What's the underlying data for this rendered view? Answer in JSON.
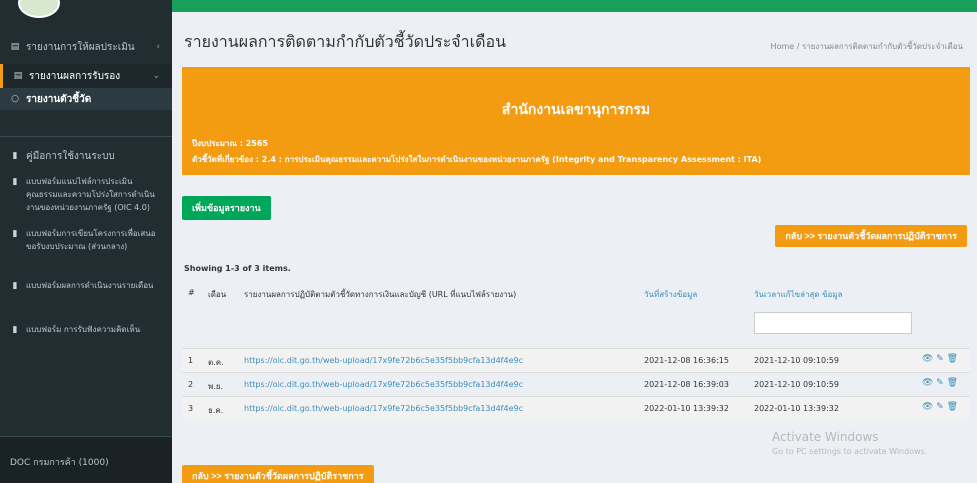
{
  "sidebar": {
    "items": [
      {
        "label": "รายงานการให้ผลประเมิน",
        "icon": "document-icon"
      },
      {
        "label": "รายงานผลการรับรอง",
        "icon": "document-icon"
      },
      {
        "label": "รายงานตัวชี้วัด",
        "icon": "circle-icon"
      },
      {
        "label": "คู่มือการใช้งานระบบ",
        "icon": "book-icon"
      },
      {
        "label": "แบบฟอร์มแนบไฟล์การประเมินคุณธรรมและความโปร่งใสการดำเนินงานของหน่วยงานภาครัฐ (OIC 4.0)",
        "icon": "book-icon"
      },
      {
        "label": "แบบฟอร์มการเขียนโครงการเพื่อเสนอขอรับงบประมาณ (ส่วนกลาง)",
        "icon": "book-icon"
      },
      {
        "label": "แบบฟอร์มผลการดำเนินงานรายเดือน",
        "icon": "book-icon"
      },
      {
        "label": "แบบฟอร์ม การรับฟังความคิดเห็น",
        "icon": "book-icon"
      }
    ],
    "footer": "DOC กรมการค้า (1000)"
  },
  "header": {
    "page_title": "รายงานผลการติดตามกำกับตัวชี้วัดประจำเดือน",
    "breadcrumb": "Home / รายงานผลการติดตามกำกับตัวชี้วัดประจำเดือน"
  },
  "banner": {
    "title": "สำนักงานเลขานุการกรม",
    "line1": "ปีงบประมาณ : 2565",
    "line2": "ตัวชี้วัดที่เกี่ยวข้อง : 2.4 : การประเมินคุณธรรมและความโปร่งใสในการดำเนินงานของหน่วยงานภาครัฐ (Integrity and Transparency Assessment : ITA)"
  },
  "buttons": {
    "add_report": "เพิ่มข้อมูลรายงาน",
    "back_top": "กลับ >> รายงานตัวชี้วัดผลการปฏิบัติราชการ",
    "back_bottom": "กลับ >> รายงานตัวชี้วัดผลการปฏิบัติราชการ"
  },
  "summary": "Showing 1-3 of 3 items.",
  "table": {
    "columns": [
      "#",
      "เดือน",
      "รายงานผลการปฏิบัติตามตัวชี้วัดทางการเงินและบัญชี (URL ที่แนบไฟล์รายงาน)",
      "วันที่สร้างข้อมูล",
      "วันเวลาแก้ไขล่าสุด ข้อมูล"
    ],
    "rows": [
      {
        "num": "1",
        "month": "ต.ค.",
        "url": "https://oic.dit.go.th/web-upload/17x9fe72b6c5e35f5bb9cfa13d4f4e9c",
        "created": "2021-12-08 16:36:15",
        "updated": "2021-12-10 09:10:59"
      },
      {
        "num": "2",
        "month": "พ.ย.",
        "url": "https://oic.dit.go.th/web-upload/17x9fe72b6c5e35f5bb9cfa13d4f4e9c",
        "created": "2021-12-08 16:39:03",
        "updated": "2021-12-10 09:10:59"
      },
      {
        "num": "3",
        "month": "ธ.ค.",
        "url": "https://oic.dit.go.th/web-upload/17x9fe72b6c5e35f5bb9cfa13d4f4e9c",
        "created": "2022-01-10 13:39:32",
        "updated": "2022-01-10 13:39:32"
      }
    ],
    "actions": "👁 ✎ 🗑"
  },
  "watermark": {
    "title": "Activate Windows",
    "subtitle": "Go to PC settings to activate Windows."
  }
}
